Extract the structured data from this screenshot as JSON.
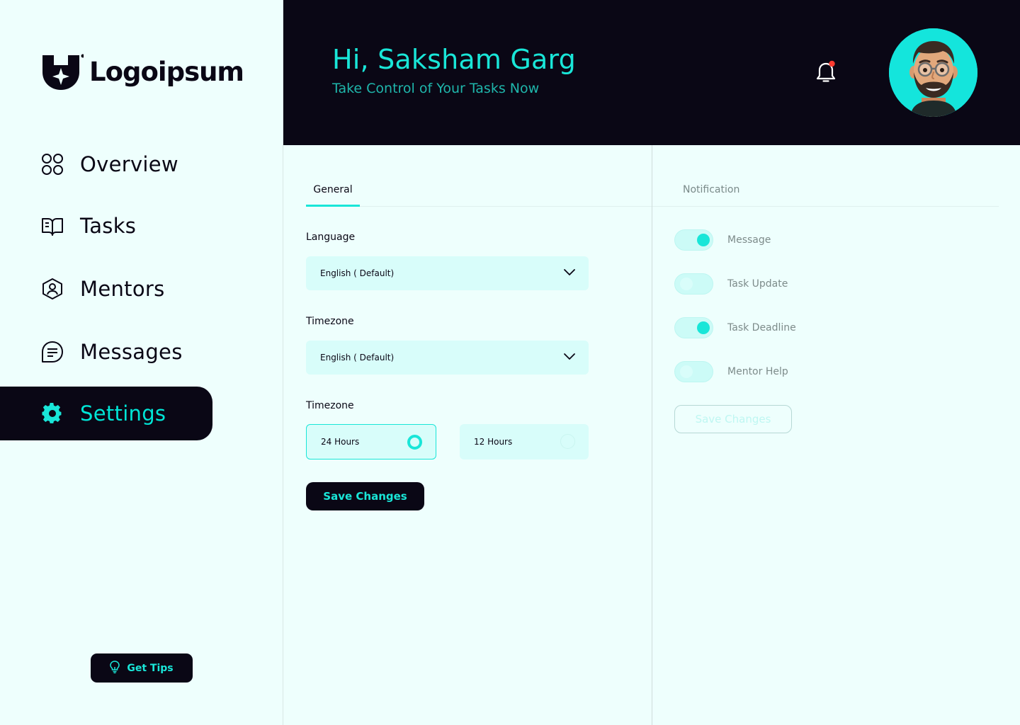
{
  "brand": {
    "name": "Logoipsum"
  },
  "colors": {
    "accent": "#19e6d8",
    "dark": "#0a0715",
    "background": "#eefffd",
    "notification_dot": "#ff3b30"
  },
  "sidebar": {
    "items": [
      {
        "label": "Overview",
        "icon": "grid-icon",
        "active": false
      },
      {
        "label": "Tasks",
        "icon": "book-icon",
        "active": false
      },
      {
        "label": "Mentors",
        "icon": "user-badge-icon",
        "active": false
      },
      {
        "label": "Messages",
        "icon": "chat-icon",
        "active": false
      },
      {
        "label": "Settings",
        "icon": "gear-icon",
        "active": true
      }
    ],
    "tips_button": "Get Tips"
  },
  "header": {
    "greeting": "Hi, Saksham Garg",
    "subtitle": "Take Control of Your Tasks Now"
  },
  "general": {
    "tab": "General",
    "language_label": "Language",
    "language_value": "English ( Default)",
    "timezone_label": "Timezone",
    "timezone_value": "English ( Default)",
    "format_label": "Timezone",
    "format_options": [
      {
        "label": "24 Hours",
        "selected": true
      },
      {
        "label": "12 Hours",
        "selected": false
      }
    ],
    "save": "Save Changes"
  },
  "notification": {
    "tab": "Notification",
    "toggles": [
      {
        "label": "Message",
        "on": true
      },
      {
        "label": "Task Update",
        "on": false
      },
      {
        "label": "Task Deadline",
        "on": true
      },
      {
        "label": "Mentor Help",
        "on": false
      }
    ],
    "save": "Save Changes"
  }
}
